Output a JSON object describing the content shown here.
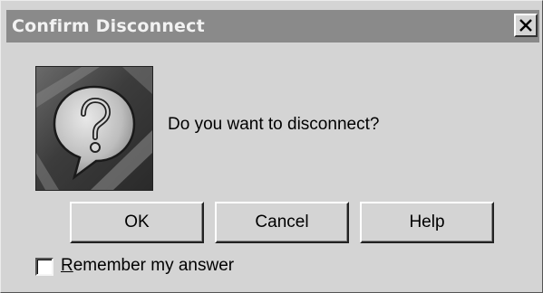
{
  "window": {
    "title": "Confirm Disconnect"
  },
  "titlebar": {
    "close_icon": "close-x-icon"
  },
  "dialog": {
    "icon": "question-speech-bubble-icon",
    "message": "Do you want to disconnect?"
  },
  "buttons": {
    "ok": "OK",
    "cancel": "Cancel",
    "help": "Help"
  },
  "remember": {
    "accel_char": "R",
    "label_rest": "emember my answer",
    "checked": false
  },
  "colors": {
    "dialog_bg": "#d4d4d4",
    "titlebar_bg": "#8a8a8a",
    "title_text": "#f2f2f2"
  }
}
